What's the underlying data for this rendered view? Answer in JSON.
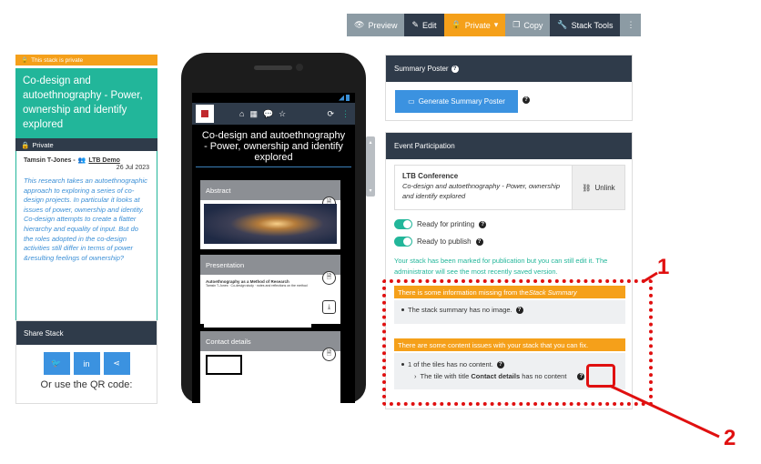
{
  "toolbar": {
    "preview": "Preview",
    "edit": "Edit",
    "private": "Private",
    "copy": "Copy",
    "stack_tools": "Stack Tools",
    "more": "⋮"
  },
  "left": {
    "private_banner": "This stack is private",
    "stack_title": "Co-design and autoethnography - Power, ownership and identify explored",
    "private_label": "Private",
    "author": "Tamsin T-Jones -",
    "group_link": "LTB Demo",
    "date": "26 Jul 2023",
    "description": "This research takes an autoethnographic approach to exploring a series of co-design projects. In particular it looks at issues of power, ownership and identity. Co-design attempts to create a flatter hierarchy and equality of input. But do the roles adopted in the co-design activities still differ in terms of power &resulting feelings of ownership?"
  },
  "share": {
    "title": "Share Stack",
    "qr_text": "Or use the QR code:",
    "buttons": [
      "twitter-icon",
      "linkedin-icon",
      "share-icon"
    ]
  },
  "phone": {
    "stack_title": "Co-design and autoethnography - Power, ownership and identify explored",
    "tiles": [
      {
        "title": "Abstract"
      },
      {
        "title": "Presentation",
        "thumb_title": "Autoethnography as a Method of Research",
        "thumb_text": "Tamsin T-Jones · Co-design study · notes and reflections on the method"
      },
      {
        "title": "Contact details"
      }
    ]
  },
  "summary_poster": {
    "title": "Summary Poster",
    "button": "Generate Summary Poster"
  },
  "event": {
    "title": "Event Participation",
    "conference": "LTB Conference",
    "stack_name": "Co-design and autoethnography - Power, ownership and identify explored",
    "unlink": "Unlink",
    "ready_printing": "Ready for printing",
    "ready_publish": "Ready to publish",
    "ready_printing_on": true,
    "ready_publish_on": true,
    "publish_message": "Your stack has been marked for publication but you can still edit it. The administrator will see the most recently saved version.",
    "warning1_prefix": "There is some information missing from the ",
    "warning1_em": "Stack Summary",
    "warning1_item": "The stack summary has no image.",
    "warning2": "There are some content issues with your stack that you can fix.",
    "warning2_item": "1 of the tiles has no content.",
    "warning2_sub_prefix": "The tile with title ",
    "warning2_sub_bold": "Contact details",
    "warning2_sub_suffix": " has no content"
  },
  "annotations": {
    "label1": "1",
    "label2": "2",
    "color": "#e01010"
  }
}
